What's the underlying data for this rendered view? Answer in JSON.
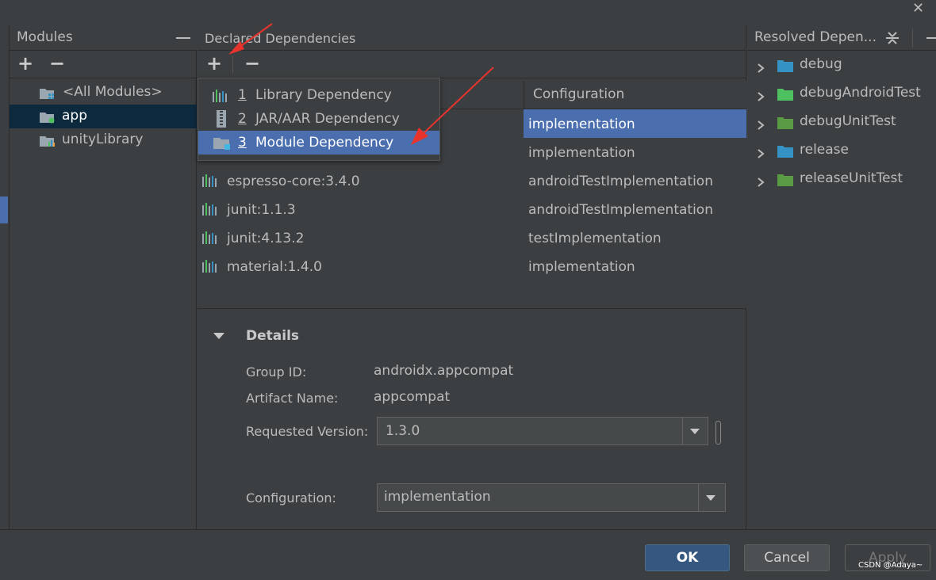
{
  "window": {
    "close_glyph": "✕"
  },
  "modules": {
    "title": "Modules",
    "add_glyph": "+",
    "remove_glyph": "−",
    "items": [
      {
        "label": "<All Modules>"
      },
      {
        "label": "app"
      },
      {
        "label": "unityLibrary"
      }
    ]
  },
  "declared": {
    "title": "Declared Dependencies",
    "add_glyph": "+",
    "remove_glyph": "−",
    "column_configuration": "Configuration",
    "rows": [
      {
        "name": "",
        "configuration": "implementation"
      },
      {
        "name": "",
        "configuration": "implementation"
      },
      {
        "name": "espresso-core:3.4.0",
        "configuration": "androidTestImplementation"
      },
      {
        "name": "junit:1.1.3",
        "configuration": "androidTestImplementation"
      },
      {
        "name": "junit:4.13.2",
        "configuration": "testImplementation"
      },
      {
        "name": "material:1.4.0",
        "configuration": "implementation"
      }
    ]
  },
  "popup": {
    "items": [
      {
        "number": "1",
        "label": "Library Dependency"
      },
      {
        "number": "2",
        "label": "JAR/AAR Dependency"
      },
      {
        "number": "3",
        "label": "Module Dependency"
      }
    ]
  },
  "details": {
    "title": "Details",
    "group_id_label": "Group ID:",
    "group_id_value": "androidx.appcompat",
    "artifact_label": "Artifact Name:",
    "artifact_value": "appcompat",
    "requested_version_label": "Requested Version:",
    "requested_version_value": "1.3.0",
    "configuration_label": "Configuration:",
    "configuration_value": "implementation"
  },
  "resolved": {
    "title": "Resolved Depen...",
    "items": [
      {
        "label": "debug",
        "color": "#3592c4"
      },
      {
        "label": "debugAndroidTest",
        "color": "#4fc05f"
      },
      {
        "label": "debugUnitTest",
        "color": "#5a9a44"
      },
      {
        "label": "release",
        "color": "#3592c4"
      },
      {
        "label": "releaseUnitTest",
        "color": "#5a9a44"
      }
    ]
  },
  "footer": {
    "ok_label": "OK",
    "cancel_label": "Cancel",
    "apply_label": "Apply",
    "watermark": "CSDN @Adaya~"
  },
  "colors": {
    "selection": "#4b6eaf",
    "annotation_arrow": "#e8332d"
  }
}
